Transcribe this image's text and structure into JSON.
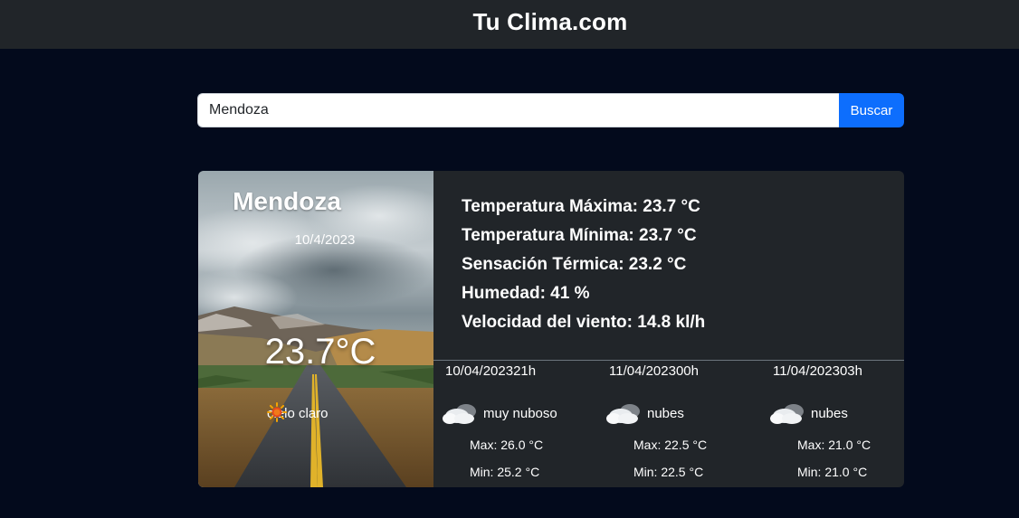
{
  "header": {
    "title": "Tu Clima.com"
  },
  "search": {
    "value": "Mendoza",
    "button_label": "Buscar"
  },
  "current": {
    "city": "Mendoza",
    "date": "10/4/2023",
    "temperature": "23.7°C",
    "condition": "cielo claro",
    "condition_icon": "sun-icon"
  },
  "details": [
    {
      "text": "Temperatura Máxima: 23.7 °C"
    },
    {
      "text": "Temperatura Mínima: 23.7 °C"
    },
    {
      "text": "Sensación Térmica: 23.2 °C"
    },
    {
      "text": "Humedad: 41 %"
    },
    {
      "text": "Velocidad del viento: 14.8 kl/h"
    }
  ],
  "forecast": [
    {
      "datetime": "10/04/202321h",
      "condition": "muy nuboso",
      "icon": "cloud-icon",
      "max": "Max: 26.0 °C",
      "min": "Min: 25.2 °C"
    },
    {
      "datetime": "11/04/202300h",
      "condition": "nubes",
      "icon": "cloud-icon",
      "max": "Max: 22.5 °C",
      "min": "Min: 22.5 °C"
    },
    {
      "datetime": "11/04/202303h",
      "condition": "nubes",
      "icon": "cloud-icon",
      "max": "Max: 21.0 °C",
      "min": "Min: 21.0 °C"
    }
  ],
  "colors": {
    "page_background": "#030a1c",
    "header_background": "#212529",
    "card_background": "#212529",
    "accent": "#0d6efd"
  }
}
